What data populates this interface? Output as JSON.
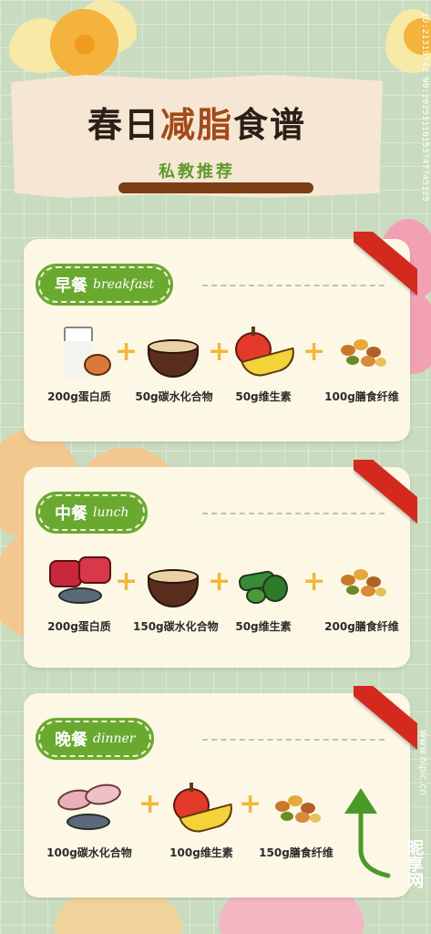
{
  "header": {
    "title_part1": "春日",
    "title_accent": "减脂",
    "title_part2": "食谱",
    "subtitle": "私教推荐"
  },
  "meals": [
    {
      "label_cn": "早餐",
      "label_en": "breakfast",
      "items": [
        {
          "caption": "200g蛋白质",
          "icon": "milk-egg-icon"
        },
        {
          "caption": "50g碳水化合物",
          "icon": "oat-bowl-icon"
        },
        {
          "caption": "50g维生素",
          "icon": "apple-banana-icon"
        },
        {
          "caption": "100g膳食纤维",
          "icon": "nuts-icon"
        }
      ]
    },
    {
      "label_cn": "中餐",
      "label_en": "lunch",
      "items": [
        {
          "caption": "200g蛋白质",
          "icon": "meat-fish-icon"
        },
        {
          "caption": "150g碳水化合物",
          "icon": "oat-bowl-icon"
        },
        {
          "caption": "50g维生素",
          "icon": "vegetables-icon"
        },
        {
          "caption": "200g膳食纤维",
          "icon": "nuts-icon"
        }
      ]
    },
    {
      "label_cn": "晚餐",
      "label_en": "dinner",
      "items": [
        {
          "caption": "100g碳水化合物",
          "icon": "sweet-potato-fish-icon"
        },
        {
          "caption": "100g维生素",
          "icon": "apple-banana-icon"
        },
        {
          "caption": "150g膳食纤维",
          "icon": "nuts-icon"
        }
      ]
    }
  ],
  "side_text": "ID:21319742 NO:20251118153747745125",
  "watermark": "www.nipic.cn",
  "watermark_logo": "昵享网",
  "colors": {
    "background": "#c9dcc0",
    "card": "#fdf8e6",
    "label_green": "#6aa92f",
    "ribbon_red": "#d42a1e",
    "plus_yellow": "#f2b63b",
    "title_accent": "#a24a1a"
  }
}
